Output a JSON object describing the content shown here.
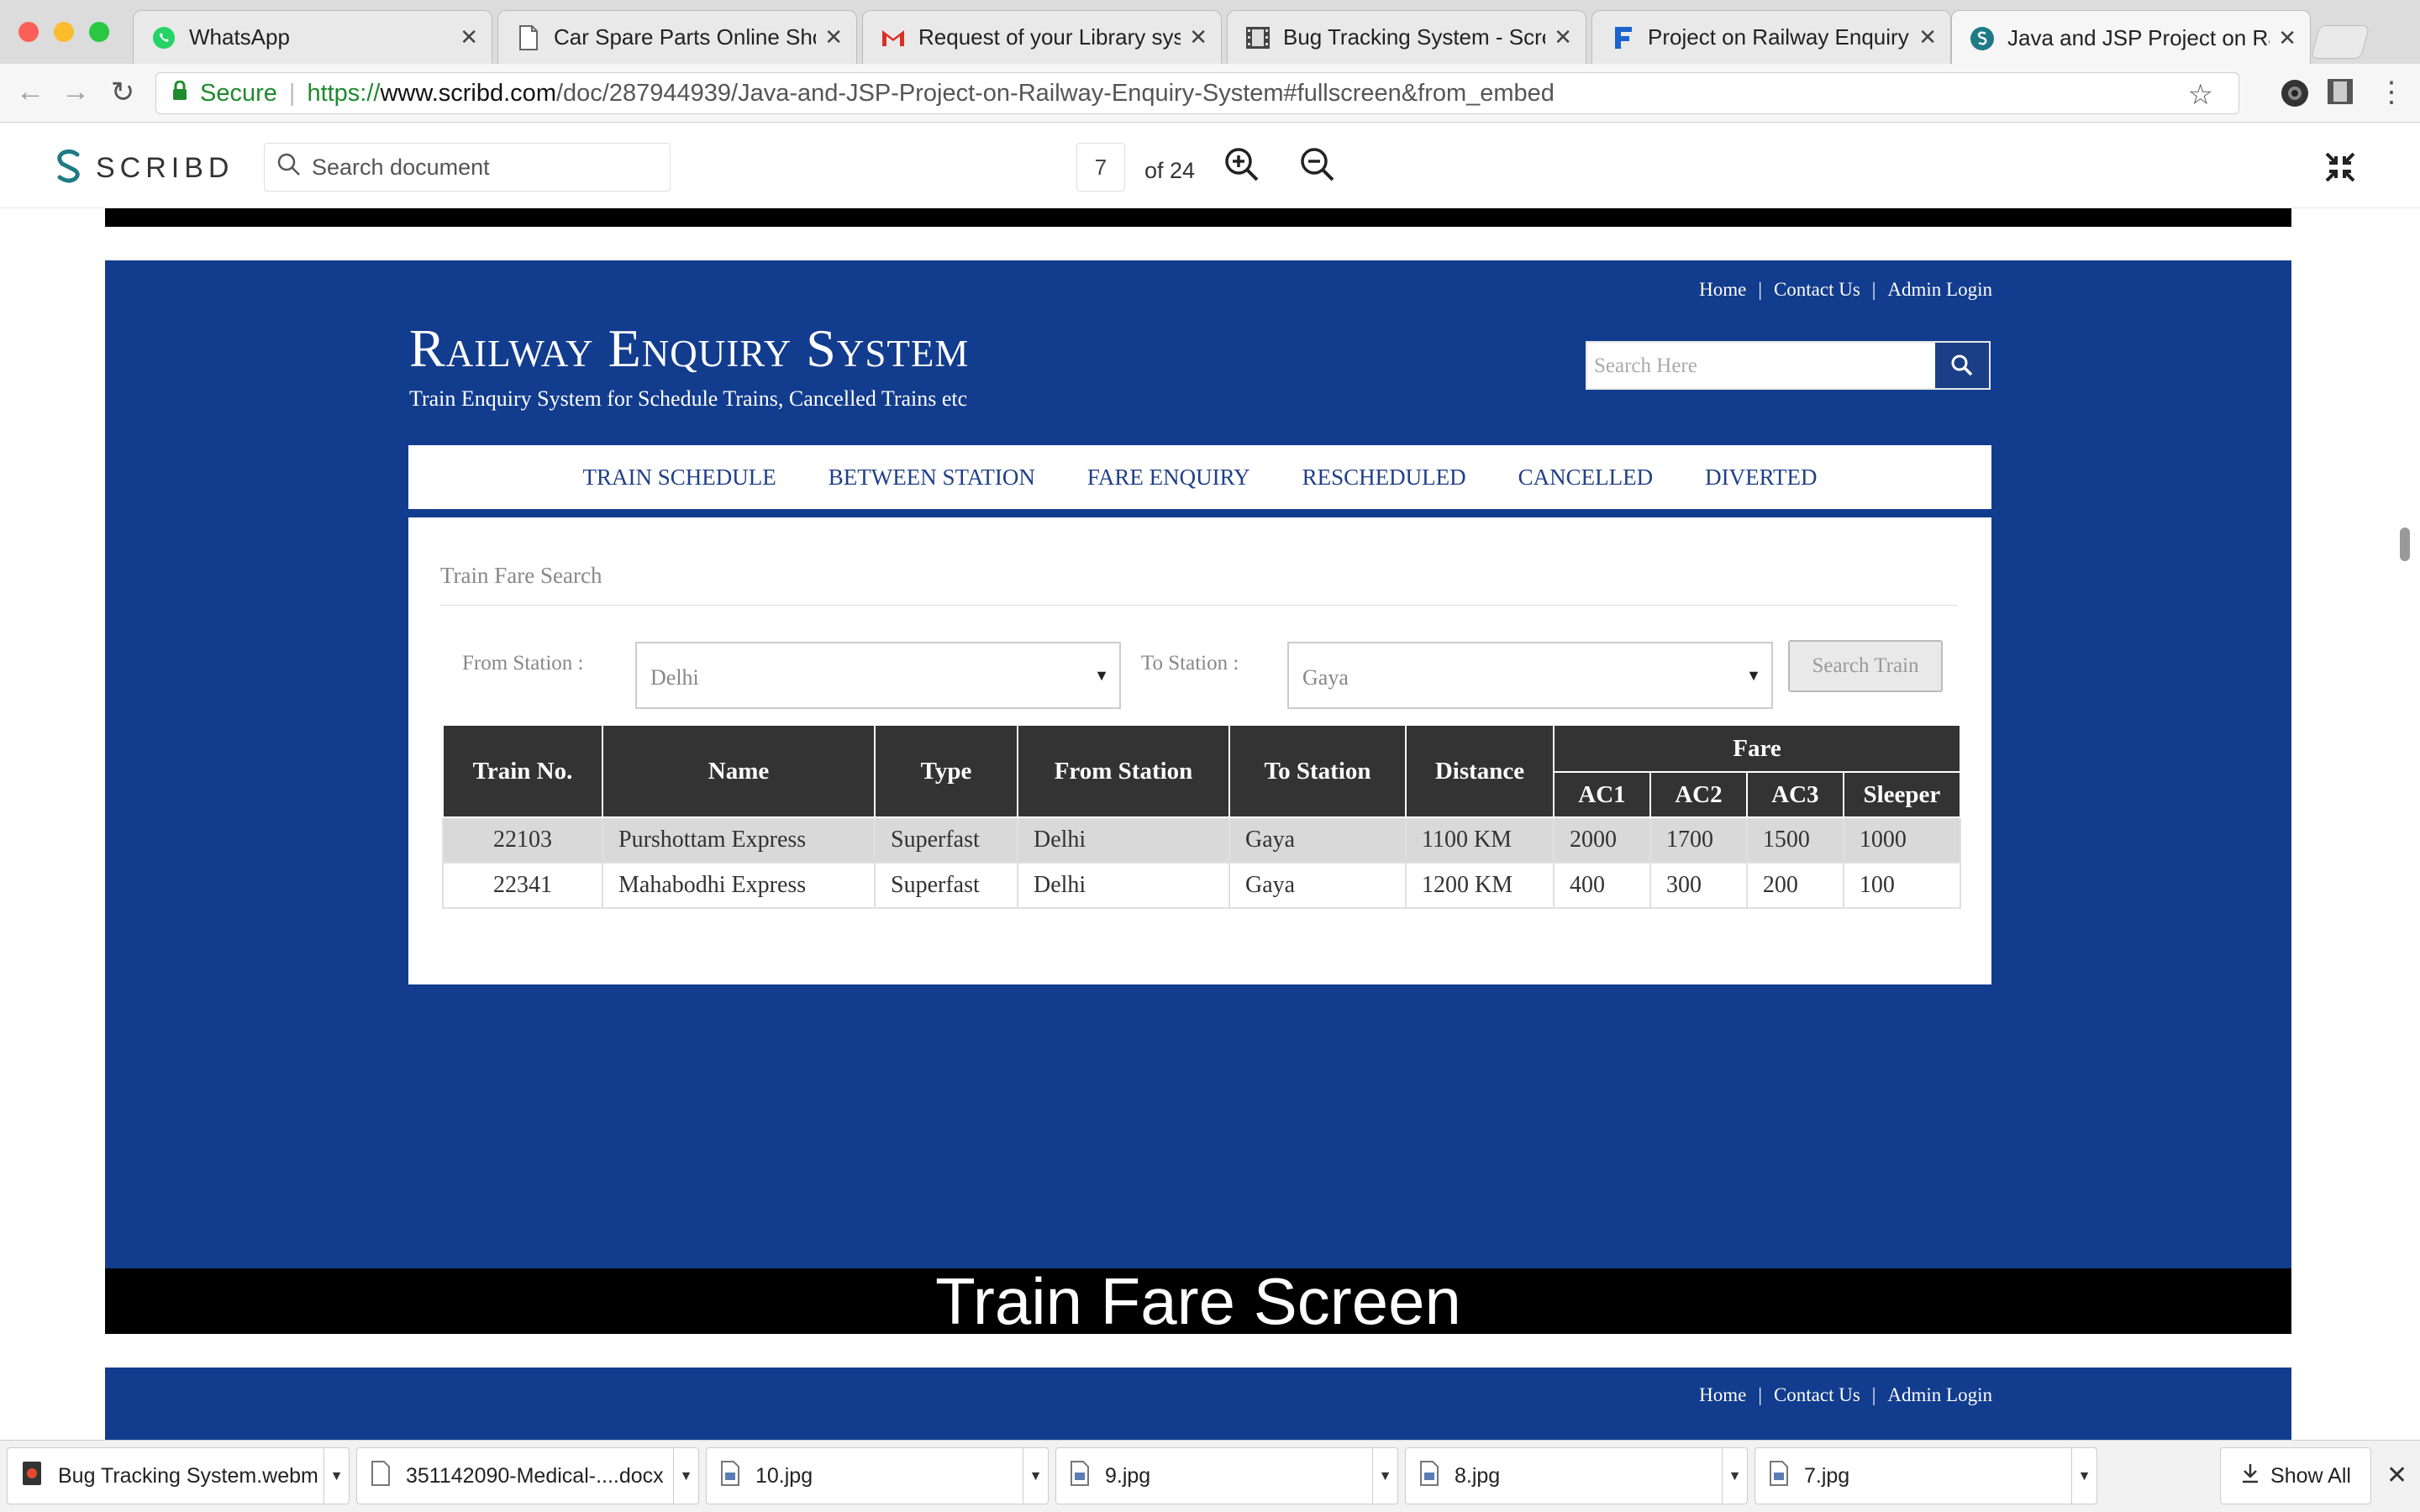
{
  "browser": {
    "tabs": [
      {
        "title": "WhatsApp",
        "icon": "whatsapp-icon"
      },
      {
        "title": "Car Spare Parts Online Shop",
        "icon": "document-icon"
      },
      {
        "title": "Request of your Library syst",
        "icon": "gmail-icon"
      },
      {
        "title": "Bug Tracking System - Scre",
        "icon": "film-icon"
      },
      {
        "title": "Project on Railway Enquiry S",
        "icon": "f-icon"
      },
      {
        "title": "Java and JSP Project on Rail",
        "icon": "scribd-icon"
      }
    ],
    "secure_label": "Secure",
    "url_scheme": "https://",
    "url_host": "www.scribd.com",
    "url_path": "/doc/287944939/Java-and-JSP-Project-on-Railway-Enquiry-System#fullscreen&from_embed"
  },
  "viewer": {
    "brand": "SCRIBD",
    "search_placeholder": "Search document",
    "page_number": "7",
    "page_total": "of 24"
  },
  "site": {
    "top_links": [
      "Home",
      "Contact Us",
      "Admin Login"
    ],
    "title": "Railway Enquiry System",
    "subtitle": "Train Enquiry System for Schedule Trains, Cancelled Trains etc",
    "search_placeholder": "Search Here",
    "menu": [
      "TRAIN SCHEDULE",
      "BETWEEN STATION",
      "FARE ENQUIRY",
      "RESCHEDULED",
      "CANCELLED",
      "DIVERTED"
    ],
    "fare_title": "Train Fare Search",
    "from_label": "From Station :",
    "from_value": "Delhi",
    "to_label": "To Station :",
    "to_value": "Gaya",
    "search_button": "Search Train",
    "table": {
      "headers": [
        "Train No.",
        "Name",
        "Type",
        "From Station",
        "To Station",
        "Distance"
      ],
      "fare_header": "Fare",
      "fare_subheaders": [
        "AC1",
        "AC2",
        "AC3",
        "Sleeper"
      ],
      "rows": [
        [
          "22103",
          "Purshottam Express",
          "Superfast",
          "Delhi",
          "Gaya",
          "1100 KM",
          "2000",
          "1700",
          "1500",
          "1000"
        ],
        [
          "22341",
          "Mahabodhi Express",
          "Superfast",
          "Delhi",
          "Gaya",
          "1200 KM",
          "400",
          "300",
          "200",
          "100"
        ]
      ]
    },
    "caption": "Train Fare Screen"
  },
  "downloads": {
    "items": [
      "Bug Tracking System.webm",
      "351142090-Medical-....docx",
      "10.jpg",
      "9.jpg",
      "8.jpg",
      "7.jpg"
    ],
    "show_all": "Show All"
  },
  "colors": {
    "page_blue": "#123c8e",
    "menu_text": "#203f88",
    "table_header": "#333333",
    "secure_green": "#1e8a2e"
  }
}
